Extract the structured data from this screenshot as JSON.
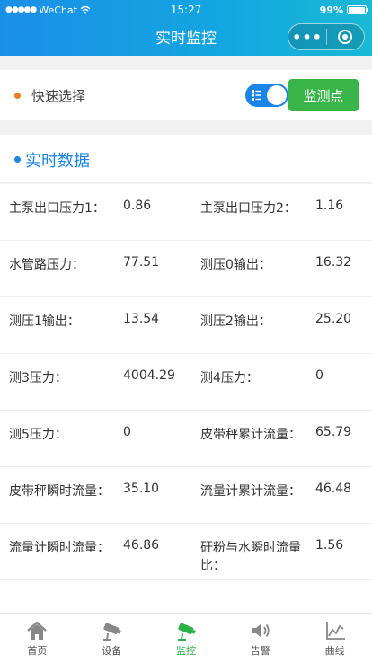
{
  "status_bar": {
    "carrier": "WeChat",
    "time": "15:27",
    "battery": "99%",
    "battery_level": 0.99
  },
  "nav": {
    "title": "实时监控",
    "more_icon": "more-dots-icon",
    "close_icon": "target-circle-icon"
  },
  "quick_select": {
    "label": "快速选择",
    "toggle_on": true,
    "button_label": "监测点",
    "accent": "#39b54a"
  },
  "realtime": {
    "title": "实时数据",
    "accent": "#1a84e8",
    "rows": [
      [
        {
          "label": "主泵出口压力1：",
          "value": "0.86"
        },
        {
          "label": "主泵出口压力2：",
          "value": "1.16"
        }
      ],
      [
        {
          "label": "水管路压力：",
          "value": "77.51"
        },
        {
          "label": "测压0输出：",
          "value": "16.32"
        }
      ],
      [
        {
          "label": "测压1输出：",
          "value": "13.54"
        },
        {
          "label": "测压2输出：",
          "value": "25.20"
        }
      ],
      [
        {
          "label": "测3压力：",
          "value": "4004.29"
        },
        {
          "label": "测4压力：",
          "value": "0"
        }
      ],
      [
        {
          "label": "测5压力：",
          "value": "0"
        },
        {
          "label": "皮带秤累计流量：",
          "value": "65.79"
        }
      ],
      [
        {
          "label": "皮带秤瞬时流量：",
          "value": "35.10"
        },
        {
          "label": "流量计累计流量：",
          "value": "46.48"
        }
      ],
      [
        {
          "label": "流量计瞬时流量：",
          "value": "46.86"
        },
        {
          "label": "矸粉与水瞬时流量比：",
          "value": "1.56"
        }
      ],
      [
        {
          "label": "",
          "value": ""
        },
        {
          "label": "",
          "value": ""
        }
      ]
    ]
  },
  "tabbar": {
    "active": "监控",
    "active_color": "#2db04a",
    "items": [
      {
        "label": "首页",
        "icon": "home-icon"
      },
      {
        "label": "设备",
        "icon": "camera-icon"
      },
      {
        "label": "监控",
        "icon": "camera-icon"
      },
      {
        "label": "告警",
        "icon": "speaker-icon"
      },
      {
        "label": "曲线",
        "icon": "chart-icon"
      }
    ]
  }
}
